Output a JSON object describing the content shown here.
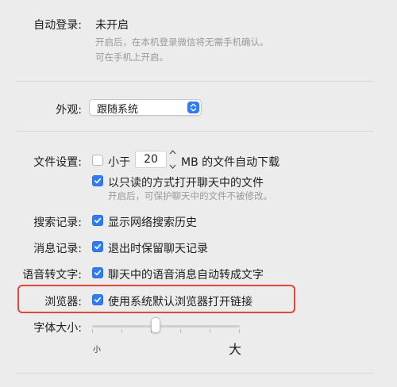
{
  "auto_login": {
    "label": "自动登录:",
    "value": "未开启",
    "hint_line1": "开启后，在本机登录微信将无需手机确认。",
    "hint_line2": "可在手机上开启。"
  },
  "appearance": {
    "label": "外观:",
    "selected": "跟随系统"
  },
  "file_settings": {
    "label": "文件设置:",
    "size_prefix": "小于",
    "size_value": "20",
    "size_suffix": "MB 的文件自动下载",
    "auto_download_checked": false,
    "readonly_label": "以只读的方式打开聊天中的文件",
    "readonly_checked": true,
    "readonly_hint": "开启后，可保护聊天中的文件不被修改。"
  },
  "search_history": {
    "label": "搜索记录:",
    "option": "显示网络搜索历史",
    "checked": true
  },
  "message_history": {
    "label": "消息记录:",
    "option": "退出时保留聊天记录",
    "checked": true
  },
  "voice_to_text": {
    "label": "语音转文字:",
    "option": "聊天中的语音消息自动转成文字",
    "checked": true
  },
  "browser": {
    "label": "浏览器:",
    "option": "使用系统默认浏览器打开链接",
    "checked": true
  },
  "font_size": {
    "label": "字体大小:",
    "small": "小",
    "large": "大",
    "level_fraction": 0.4
  },
  "colors": {
    "accent": "#2f7cf6",
    "highlight": "#e0483a"
  }
}
